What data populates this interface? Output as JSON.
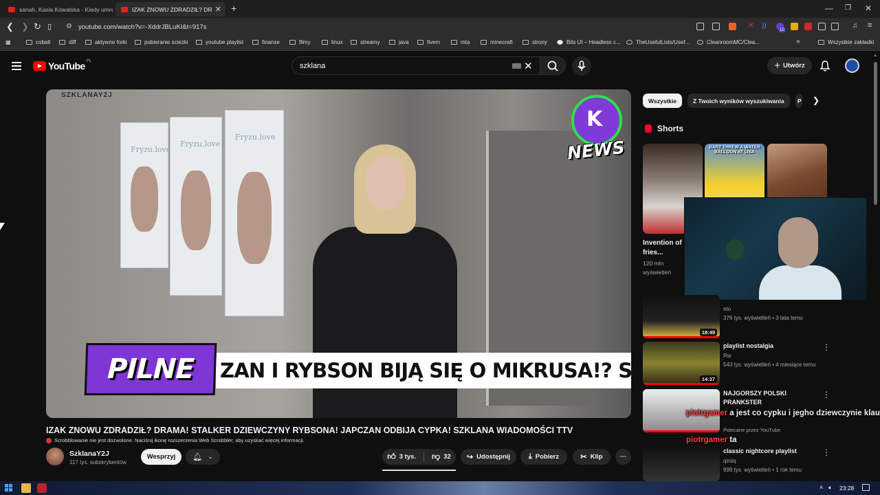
{
  "browser": {
    "tabs": [
      {
        "label": "sanah, Kasia Kowalska - Kiedy umrę (",
        "active": false
      },
      {
        "label": "IZAK ZNOWU ZDRADZIŁ? DR",
        "active": true
      }
    ],
    "new_tab": "+",
    "url": "youtube.com/watch?v=-XddrJBLuKI&t=917s",
    "extension_badge": "10",
    "bookmarks": [
      "cobalt",
      "diff",
      "aktywne forki",
      "pobieranie sciezki",
      "youtube playlist",
      "finanse",
      "filmy",
      "linux",
      "streamy",
      "java",
      "fivem",
      "mta",
      "minecraft",
      "strony",
      "Bits UI – Headless c...",
      "TheUsefulLists/Usef...",
      "CleanroomMC/Clea..."
    ],
    "bookmarks_overflow": "»",
    "all_bookmarks": "Wszystkie zakładki"
  },
  "youtube": {
    "logo_text": "YouTube",
    "logo_region": "PL",
    "search_value": "szklana",
    "create_label": "Utwórz"
  },
  "video": {
    "watermark": "SZKLANAY2J",
    "badge_text": "NEWS",
    "badge_logo": "K",
    "pilne": "PILNE",
    "ticker": "ZAN I RYBSON BIJĄ SIĘ O MIKRUSA!? STARY WRÓC",
    "posters": [
      "Fryzu.love",
      "Fryzu.love",
      "Fryzu.love"
    ]
  },
  "below": {
    "title": "IZAK ZNOWU ZDRADZIŁ? DRAMA! STALKER DZIEWCZYNY RYBSONA! JAPCZAN ODBIJA CYPKA! SZKLANA WIADOMOŚCI TTV",
    "scrobbler_note": "Scrobblowanie nie jest dozwolone. Naciśnij ikonę rozszerzenia Web Scrobbler, aby uzyskać więcej informacji.",
    "channel_name": "SzklanaY2J",
    "subscribers": "117 tys. subskrybentów",
    "join_label": "Wesprzyj",
    "likes": "3 tys.",
    "dislikes": "32",
    "share_label": "Udostępnij",
    "download_label": "Pobierz",
    "clip_label": "Klip",
    "more": "···"
  },
  "sidebar": {
    "chips": [
      "Wszystkie",
      "Z Twoich wyników wyszukiwania",
      "P"
    ],
    "shorts_heading": "Shorts",
    "shorts": [
      {
        "title": "Invention of fries...",
        "views": "120 mln wyświetleń"
      },
      {
        "title": "",
        "views": "",
        "overlay": "BART THREW A WATER BALLOON AT LISA"
      },
      {
        "title": "",
        "views": ""
      }
    ],
    "videos": [
      {
        "title": "",
        "channel": "eto",
        "meta": "376 tys. wyświetleń • 3 lata temu",
        "duration": "18:49"
      },
      {
        "title": "playlist nostalgia",
        "channel": "Rw",
        "meta": "543 tys. wyświetleń • 4 miesiące temu",
        "duration": "14:37"
      },
      {
        "title": "NAJGORSZY POLSKI PRANKSTER",
        "channel": "",
        "meta": "Polecane przez YouTube",
        "duration": ""
      },
      {
        "title": "classic nightcore playlist",
        "channel": "qiniiq",
        "meta": "999 tys. wyświetleń • 1 rok temu",
        "duration": ""
      }
    ]
  },
  "chat_overlay": [
    {
      "nick": "piotrgamer",
      "text": " a jest co cypku i jegho dziewczynie klaudi?"
    },
    {
      "nick": "piotrgamer",
      "text": " ta"
    }
  ],
  "taskbar": {
    "clock": "23:28"
  },
  "colors": {
    "yt_red": "#ff0000",
    "purple": "#7e36d6",
    "green": "#2ee04a"
  }
}
